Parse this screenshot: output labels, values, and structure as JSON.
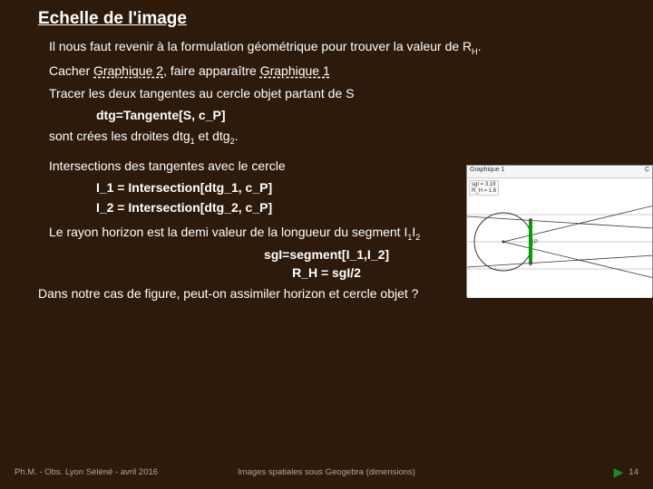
{
  "title": "Echelle de l'image",
  "lines": {
    "intro_a": "Il nous faut revenir à la formulation géométrique pour trouver la valeur de R",
    "intro_sub": "H",
    "intro_b": ".",
    "cacher_a": "Cacher ",
    "cacher_g2": "Graphique 2",
    "cacher_b": ", faire apparaître ",
    "cacher_g1": "Graphique 1",
    "tracer": "Tracer les deux tangentes au cercle objet partant de S",
    "dtg": "dtg=Tangente[S, c_P]",
    "dtg_res_a": "sont crées les droites dtg",
    "dtg_res_b": " et dtg",
    "dtg_res_c": ".",
    "intersec": "Intersections des tangentes avec le cercle",
    "i1": "I_1 = Intersection[dtg_1, c_P]",
    "i2": "I_2 = Intersection[dtg_2, c_P]",
    "rayon_a": "Le rayon horizon est la demi valeur de la longueur du segment I",
    "rayon_b": "I",
    "sgi": "sgI=segment[I_1,I_2]",
    "rh": "R_H = sgI/2",
    "question": "Dans notre cas de figure, peut-on assimiler horizon et cercle objet ?"
  },
  "figure": {
    "tab": "Graphique 1",
    "close": "C",
    "alg1": "sgI = 3.19",
    "alg2": "R_H = 1.6"
  },
  "footer": {
    "left": "Ph.M. - Obs. Lyon Séléné - avril 2016",
    "center": "Images spatiales sous Geogebra (dimensions)",
    "page": "14"
  }
}
